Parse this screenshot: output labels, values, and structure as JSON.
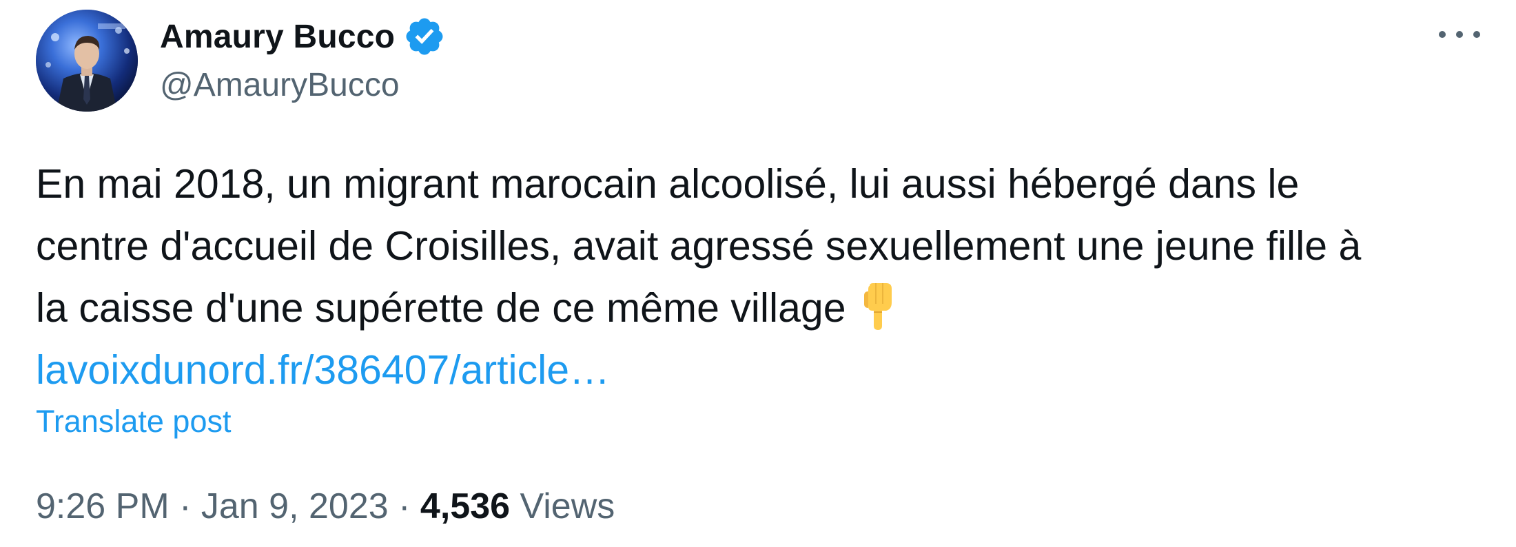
{
  "author": {
    "display_name": "Amaury Bucco",
    "handle": "@AmauryBucco",
    "verified": true
  },
  "post": {
    "text_lines": [
      "En mai 2018, un migrant marocain alcoolisé, lui aussi hébergé dans le",
      "centre d'accueil de Croisilles, avait agressé sexuellement une jeune fille à",
      "la caisse d'une supérette de ce même village"
    ],
    "emoji": "backhand-index-pointing-down",
    "link_text": "lavoixdunord.fr/386407/article…"
  },
  "actions": {
    "translate_label": "Translate post",
    "more_icon": "more-horizontal-icon"
  },
  "meta": {
    "time": "9:26 PM",
    "separator": "·",
    "date": "Jan 9, 2023",
    "views_count": "4,536",
    "views_label": "Views"
  },
  "colors": {
    "text": "#0f1419",
    "secondary": "#536471",
    "link": "#1d9bf0",
    "verified": "#1d9bf0"
  }
}
